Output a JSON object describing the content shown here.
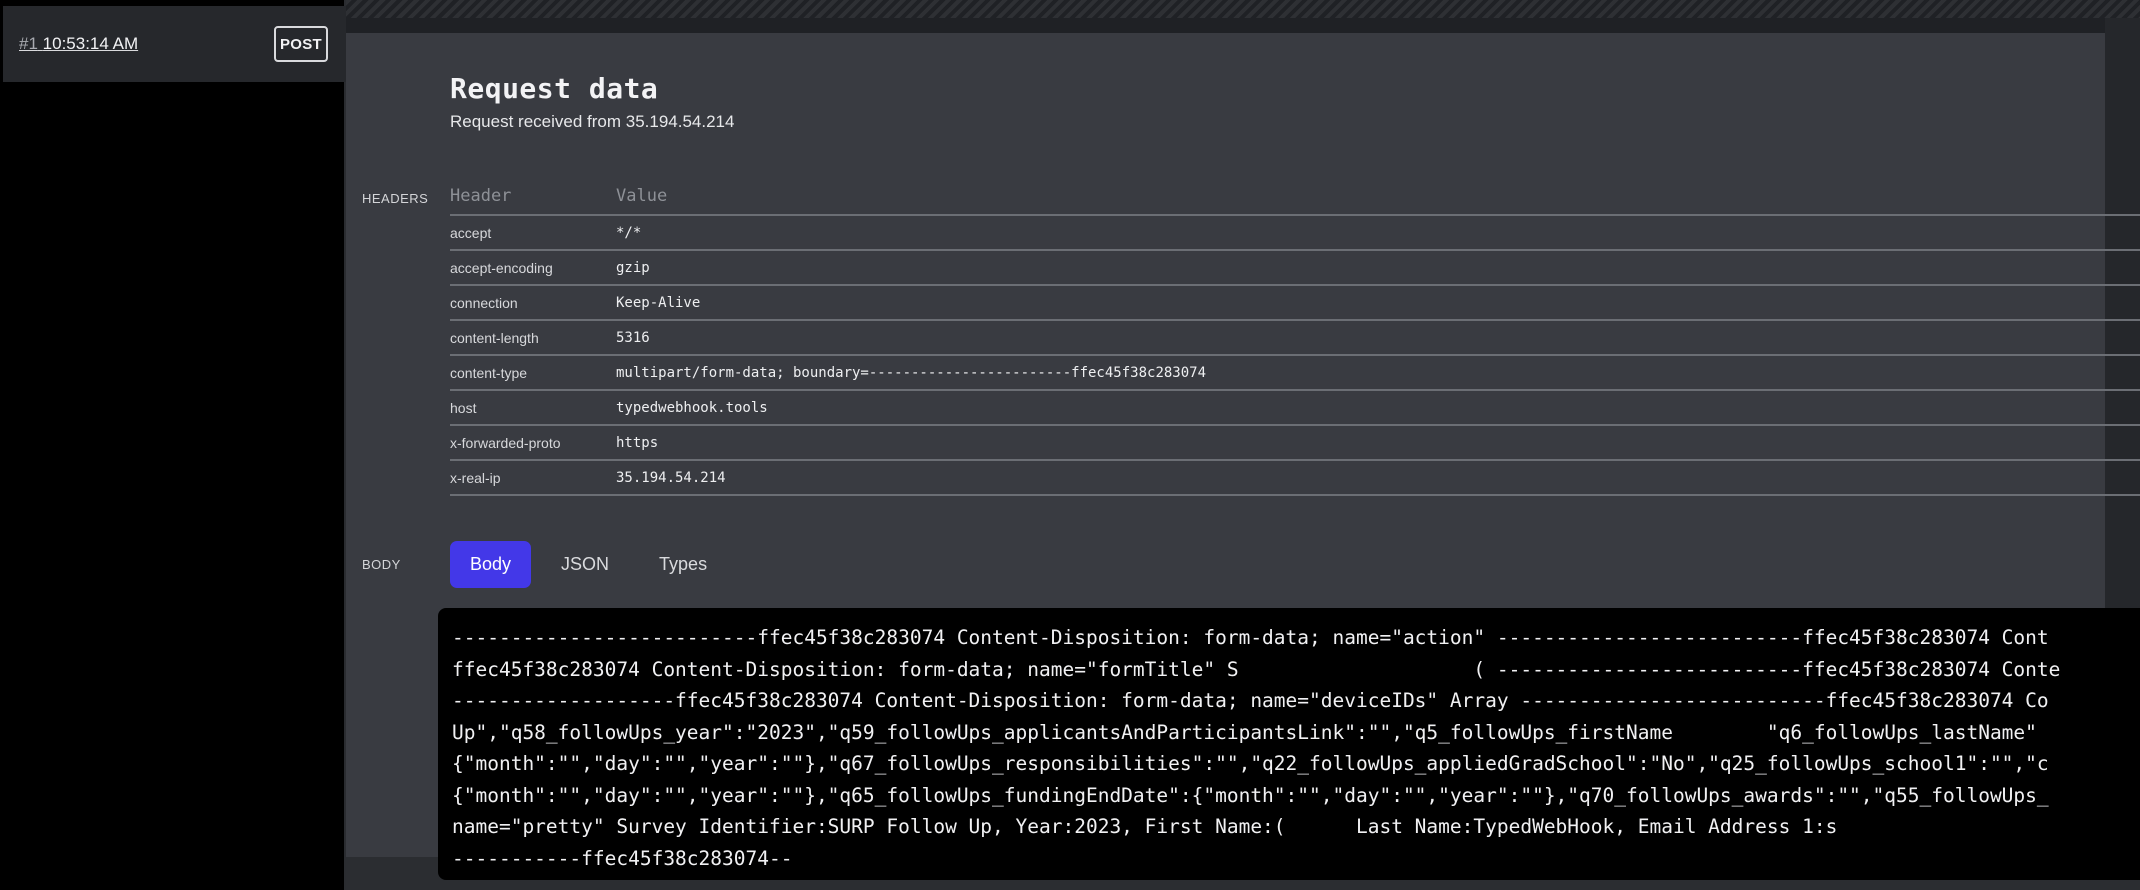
{
  "sidebar": {
    "request": {
      "number": "#1",
      "time": "10:53:14 AM",
      "method": "POST"
    }
  },
  "main": {
    "title": "Request data",
    "subtitle": "Request received from 35.194.54.214"
  },
  "headers_section": {
    "label": "HEADERS",
    "columns": [
      "Header",
      "Value"
    ],
    "rows": [
      {
        "key": "accept",
        "value": "*/*"
      },
      {
        "key": "accept-encoding",
        "value": "gzip"
      },
      {
        "key": "connection",
        "value": "Keep-Alive"
      },
      {
        "key": "content-length",
        "value": "5316"
      },
      {
        "key": "content-type",
        "value": "multipart/form-data; boundary=------------------------ffec45f38c283074"
      },
      {
        "key": "host",
        "value": "typedwebhook.tools"
      },
      {
        "key": "x-forwarded-proto",
        "value": "https"
      },
      {
        "key": "x-real-ip",
        "value": "35.194.54.214"
      }
    ]
  },
  "body_section": {
    "label": "BODY",
    "tabs": [
      "Body",
      "JSON",
      "Types"
    ],
    "active_tab": "Body",
    "lines": [
      "--------------------------ffec45f38c283074 Content-Disposition: form-data; name=\"action\" --------------------------ffec45f38c283074 Cont",
      "ffec45f38c283074 Content-Disposition: form-data; name=\"formTitle\" S                    ( --------------------------ffec45f38c283074 Conte",
      "-------------------ffec45f38c283074 Content-Disposition: form-data; name=\"deviceIDs\" Array --------------------------ffec45f38c283074 Co",
      "Up\",\"q58_followUps_year\":\"2023\",\"q59_followUps_applicantsAndParticipantsLink\":\"\",\"q5_followUps_firstName        \"q6_followUps_lastName\"",
      "{\"month\":\"\",\"day\":\"\",\"year\":\"\"},\"q67_followUps_responsibilities\":\"\",\"q22_followUps_appliedGradSchool\":\"No\",\"q25_followUps_school1\":\"\",\"c",
      "{\"month\":\"\",\"day\":\"\",\"year\":\"\"},\"q65_followUps_fundingEndDate\":{\"month\":\"\",\"day\":\"\",\"year\":\"\"},\"q70_followUps_awards\":\"\",\"q55_followUps_",
      "name=\"pretty\" Survey Identifier:SURP Follow Up, Year:2023, First Name:(      Last Name:TypedWebHook, Email Address 1:s",
      "-----------ffec45f38c283074--"
    ]
  },
  "colors": {
    "accent": "#4338e8",
    "panel": "#393b41",
    "background": "#1f2125",
    "sidebar": "#000000"
  }
}
